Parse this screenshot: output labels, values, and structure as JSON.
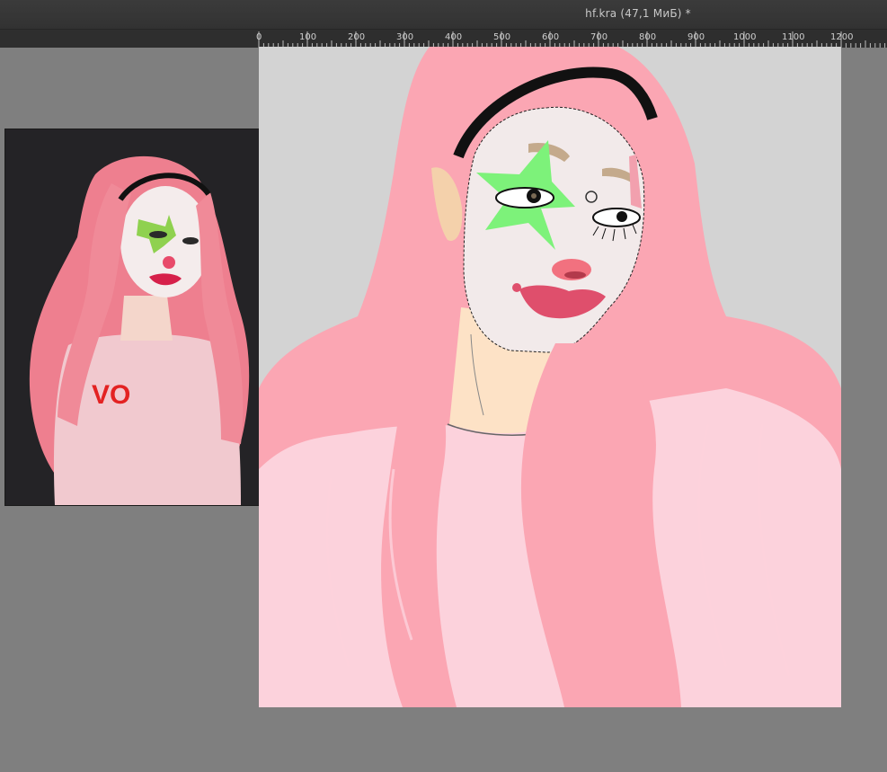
{
  "window": {
    "document_title": "hf.kra (47,1 МиБ) *"
  },
  "ruler": {
    "labels": [
      "0",
      "100",
      "200",
      "300",
      "400",
      "500",
      "600",
      "700",
      "800",
      "900",
      "1000",
      "1100",
      "1200"
    ]
  },
  "reference_image": {
    "sweater_text": "VO"
  },
  "colors": {
    "workspace": "#7f7f7f",
    "titlebar": "#353535",
    "ruler": "#2e2e2e",
    "canvas_background": "#d3d3d3",
    "hair": "#fba6b3",
    "sweater": "#fcd2dc",
    "skin": "#fde2c6",
    "face_paint": "#f2eaea",
    "star": "#7df27a",
    "nose": "#f2717f",
    "lips": "#df4f6c",
    "headband": "#111111"
  }
}
